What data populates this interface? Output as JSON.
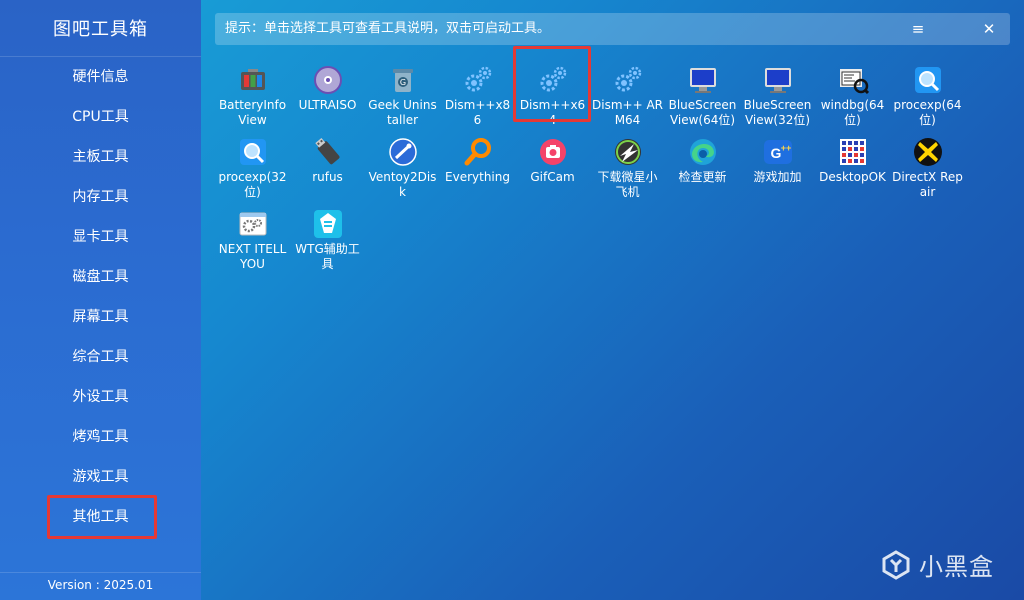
{
  "app": {
    "title": "图吧工具箱",
    "version": "Version : 2025.01"
  },
  "sidebar": {
    "items": [
      {
        "label": "硬件信息"
      },
      {
        "label": "CPU工具"
      },
      {
        "label": "主板工具"
      },
      {
        "label": "内存工具"
      },
      {
        "label": "显卡工具"
      },
      {
        "label": "磁盘工具"
      },
      {
        "label": "屏幕工具"
      },
      {
        "label": "综合工具"
      },
      {
        "label": "外设工具"
      },
      {
        "label": "烤鸡工具"
      },
      {
        "label": "游戏工具"
      },
      {
        "label": "其他工具",
        "selected": true
      }
    ]
  },
  "hint": {
    "text": "提示：单击选择工具可查看工具说明，双击可启动工具。",
    "menu_icon": "≡",
    "close_icon": "✕"
  },
  "tools": [
    {
      "label": "BatteryInfoView",
      "icon": "battery-icon"
    },
    {
      "label": "ULTRAISO",
      "icon": "disc-icon"
    },
    {
      "label": "Geek Uninstaller",
      "icon": "trash-can-icon"
    },
    {
      "label": "Dism++x86",
      "icon": "gears-icon"
    },
    {
      "label": "Dism++x64",
      "icon": "gears-icon",
      "selected": true
    },
    {
      "label": "Dism++ ARM64",
      "icon": "gears-icon"
    },
    {
      "label": "BlueScreenView(64位)",
      "icon": "monitor-icon"
    },
    {
      "label": "BlueScreenView(32位)",
      "icon": "monitor-icon"
    },
    {
      "label": "windbg(64位)",
      "icon": "debugger-icon"
    },
    {
      "label": "procexp(64位)",
      "icon": "magnifier-icon"
    },
    {
      "label": "procexp(32位)",
      "icon": "magnifier-icon"
    },
    {
      "label": "rufus",
      "icon": "usb-drive-icon"
    },
    {
      "label": "Ventoy2Disk",
      "icon": "ventoy-icon"
    },
    {
      "label": "Everything",
      "icon": "search-icon"
    },
    {
      "label": "GifCam",
      "icon": "camera-icon"
    },
    {
      "label": "下载微星小飞机",
      "icon": "afterburner-icon"
    },
    {
      "label": "检查更新",
      "icon": "edge-icon"
    },
    {
      "label": "游戏加加",
      "icon": "game-plus-icon"
    },
    {
      "label": "DesktopOK",
      "icon": "grid-icon"
    },
    {
      "label": "DirectX Repair",
      "icon": "directx-icon"
    },
    {
      "label": "NEXT ITELLYOU",
      "icon": "window-gears-icon"
    },
    {
      "label": "WTG辅助工具",
      "icon": "wtg-icon"
    }
  ],
  "watermark": {
    "text": "小黑盒"
  },
  "colors": {
    "accent_red": "#e53935",
    "sidebar_bg": "#2a63c6"
  }
}
